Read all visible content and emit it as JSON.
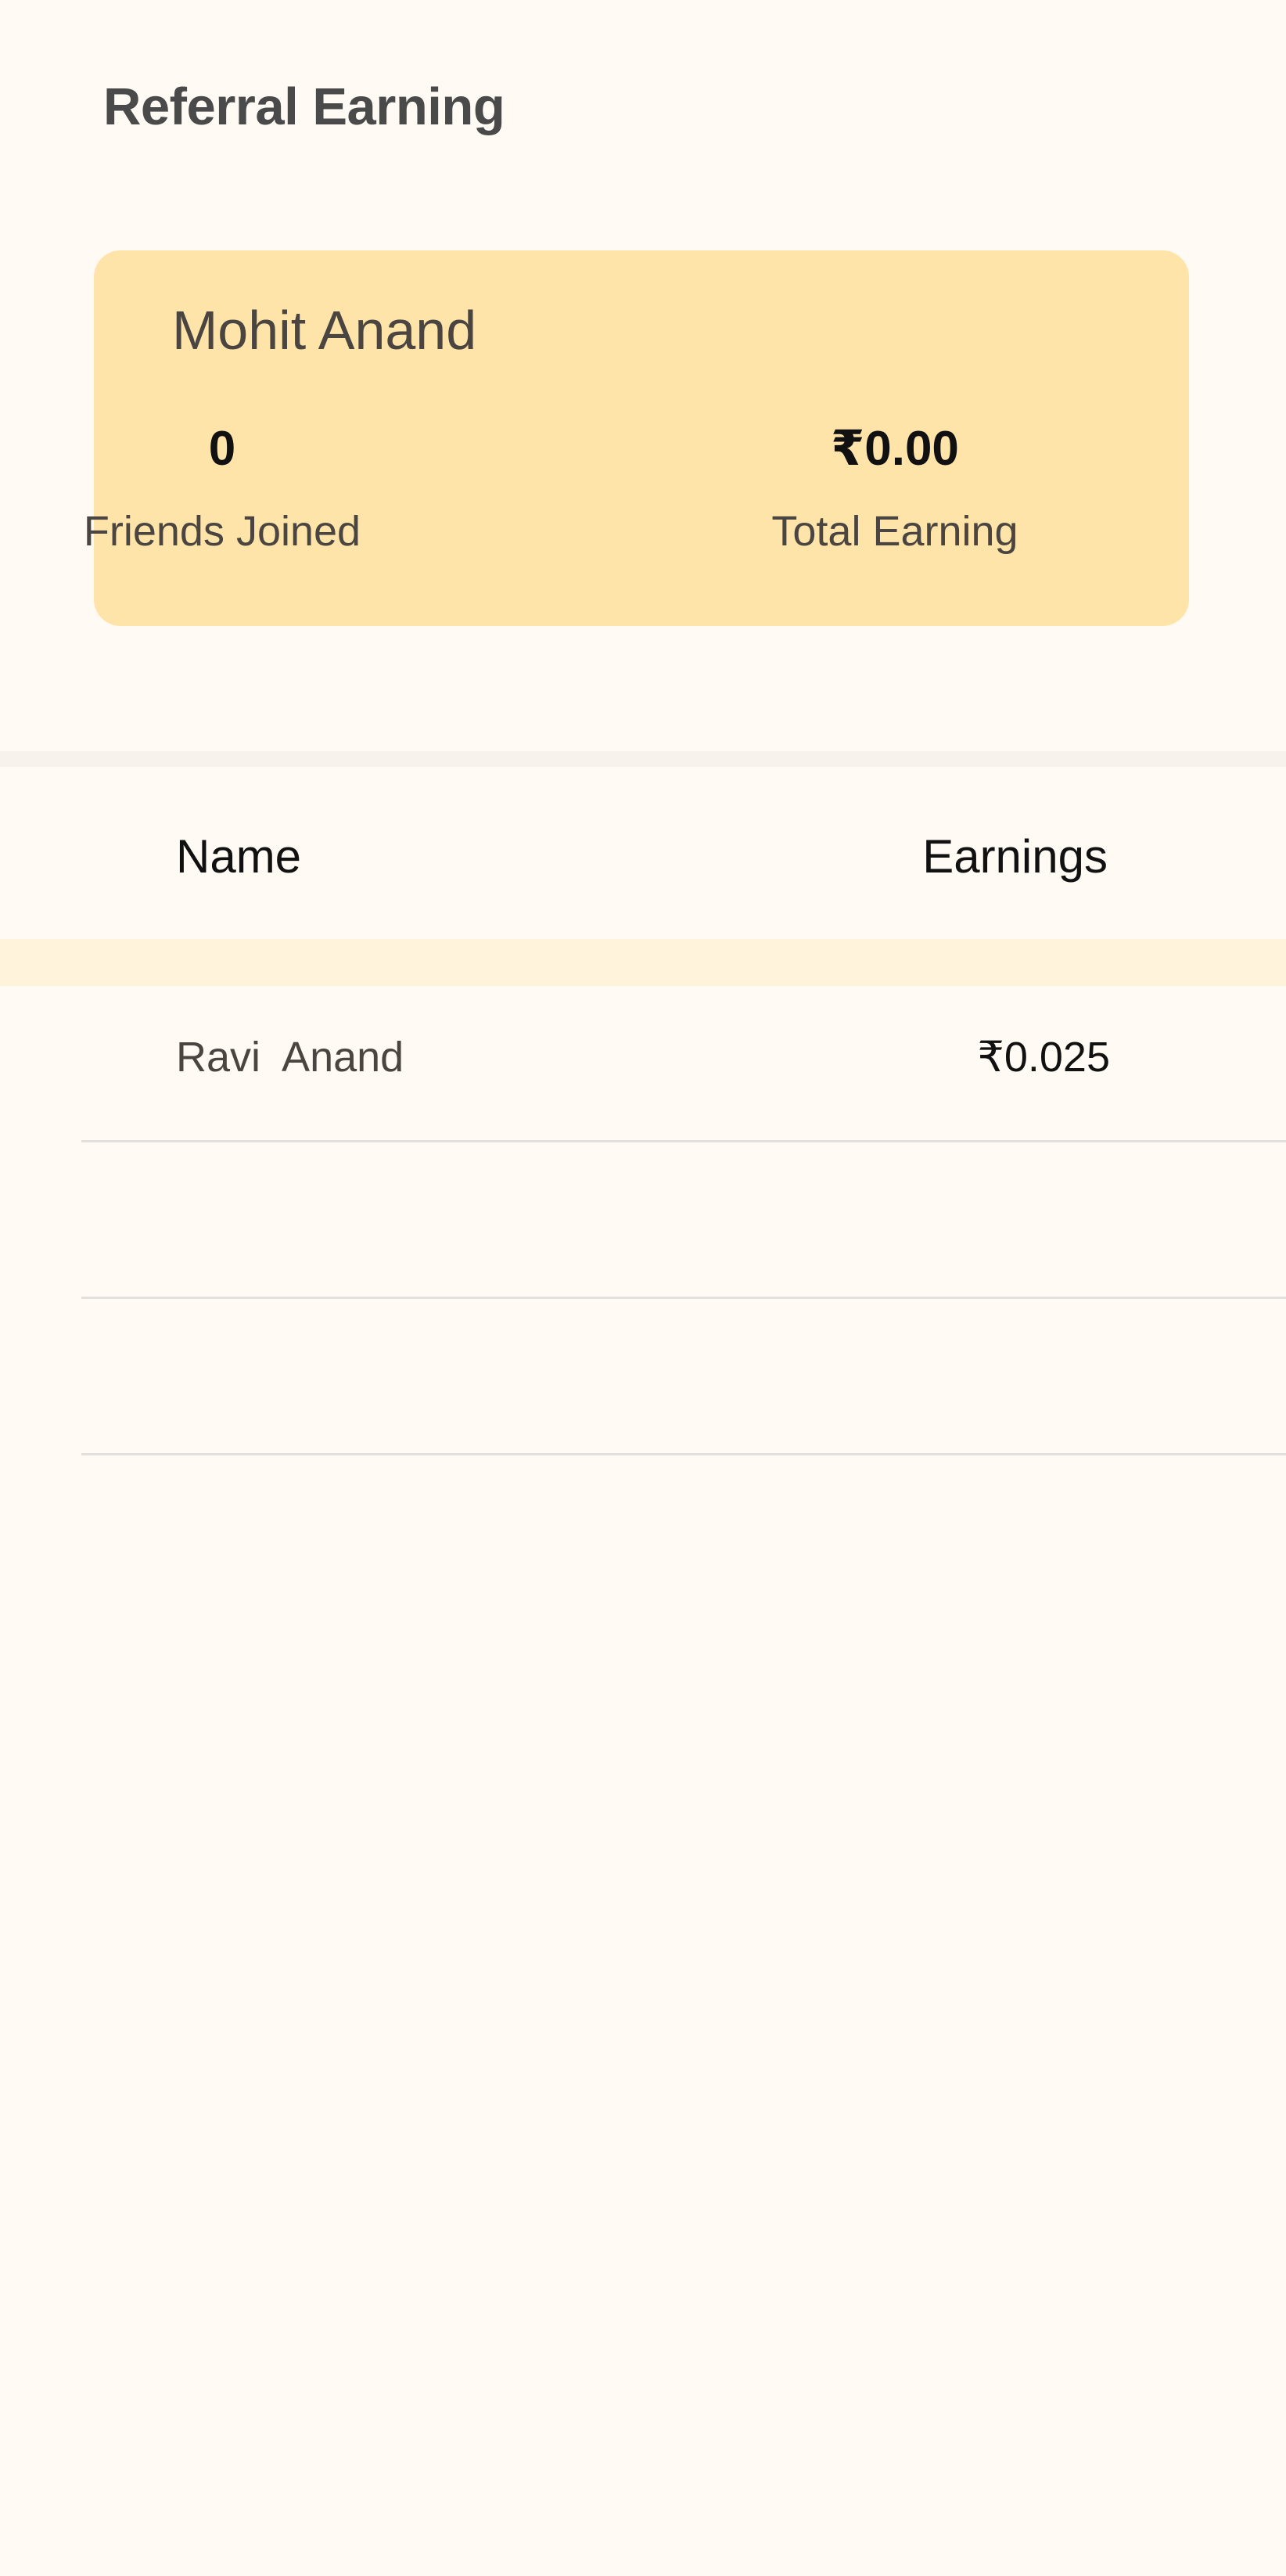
{
  "page": {
    "title": "Referral Earning"
  },
  "summary": {
    "user_name": "Mohit Anand",
    "friends_joined_value": "0",
    "friends_joined_label": "Friends Joined",
    "total_earning_value": "₹0.00",
    "total_earning_label": "Total Earning"
  },
  "table": {
    "columns": [
      "Name",
      "Earnings"
    ],
    "rows": [
      {
        "name": "Ravi  Anand",
        "earning": "₹0.025"
      },
      {
        "name": "",
        "earning": ""
      },
      {
        "name": "",
        "earning": ""
      }
    ]
  },
  "colors": {
    "background": "#fffaf3",
    "card": "#ffe4a9",
    "header_band": "#fff3dc",
    "divider": "#e2e0dc"
  }
}
